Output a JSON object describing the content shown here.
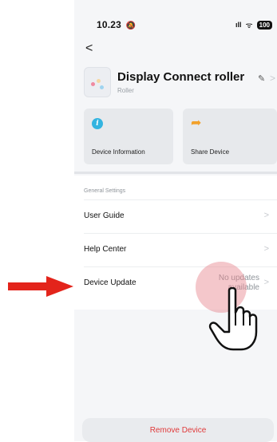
{
  "status_bar": {
    "time": "10.23",
    "bell": "🔕",
    "signal": "ıll",
    "wifi": "ᯤ",
    "battery": "100"
  },
  "header": {
    "back": "<"
  },
  "device": {
    "name": "Display Connect roller",
    "subtitle": "Roller",
    "edit_icon": "✎",
    "chevron": ">"
  },
  "cards": [
    {
      "label": "Device Information",
      "icon": "info-icon",
      "icon_glyph": "i"
    },
    {
      "label": "Share Device",
      "icon": "share-icon",
      "icon_glyph": "➦"
    }
  ],
  "settings": {
    "section_title": "General Settings",
    "items": [
      {
        "label": "User Guide",
        "chevron": ">"
      },
      {
        "label": "Help Center",
        "chevron": ">"
      },
      {
        "label": "Device Update",
        "value": "No updates available",
        "value_line1": "No updates",
        "value_line2": "available",
        "chevron": ">"
      }
    ]
  },
  "footer": {
    "remove_label": "Remove Device"
  },
  "colors": {
    "accent_red": "#e03a3a",
    "info_blue": "#33b4e0",
    "share_orange": "#f2a12b",
    "annotation_arrow": "#e3241b"
  }
}
